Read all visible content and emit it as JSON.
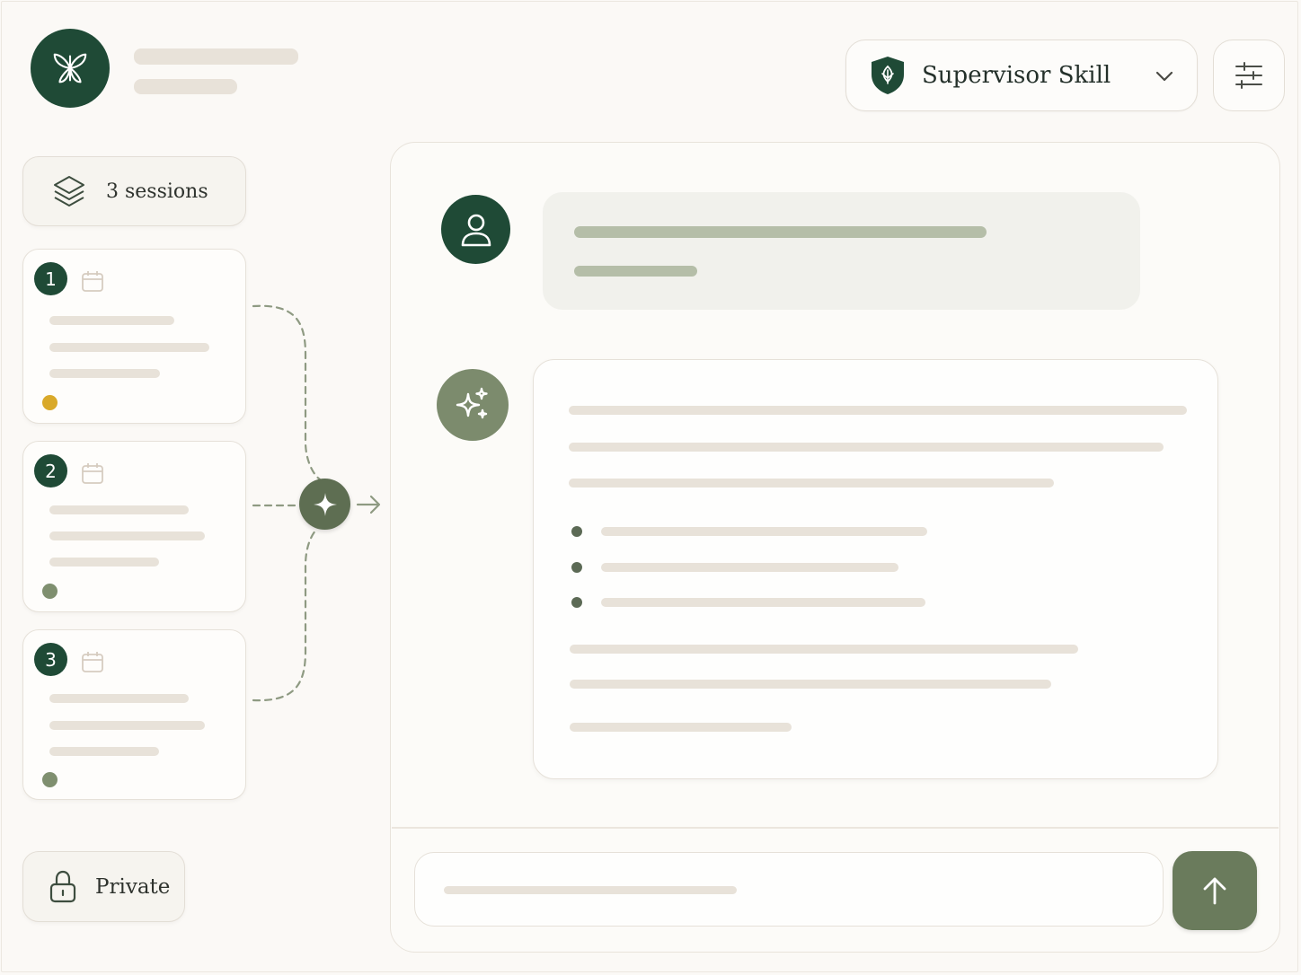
{
  "header": {
    "logo_icon": "butterfly-icon",
    "skill_select": {
      "selected": "Supervisor Skill",
      "icon": "shield-icon"
    },
    "settings_icon": "sliders-icon"
  },
  "sidebar": {
    "sessions_label": "3 sessions",
    "sessions_icon": "layers-icon",
    "sessions": [
      {
        "number": "1",
        "status_color": "#d9a92a"
      },
      {
        "number": "2",
        "status_color": "#7f8f6f"
      },
      {
        "number": "3",
        "status_color": "#7f8f6f"
      }
    ],
    "privacy_label": "Private",
    "privacy_icon": "lock-icon"
  },
  "chat": {
    "user_icon": "user-icon",
    "assistant_icon": "sparkles-icon",
    "merge_icon": "sparkle-icon",
    "send_icon": "arrow-up-icon"
  },
  "colors": {
    "brand_dark_green": "#1f4a36",
    "sage": "#6a7b5c",
    "background": "#fbf9f6",
    "skeleton": "#e8e2d9"
  }
}
